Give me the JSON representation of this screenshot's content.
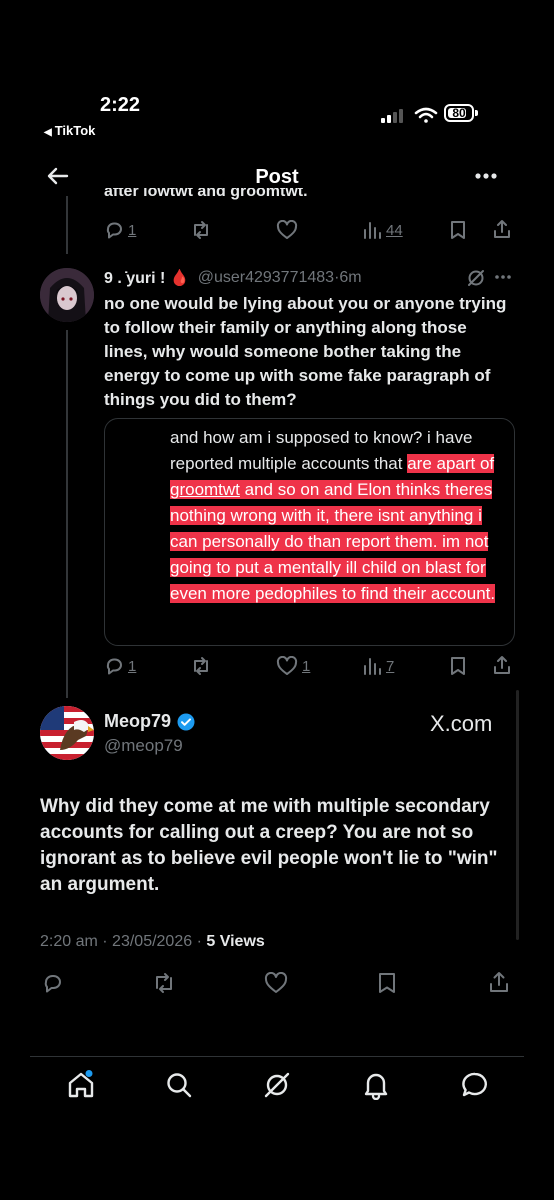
{
  "status_bar": {
    "time": "2:22",
    "back_app": "TikTok",
    "battery": "80"
  },
  "header": {
    "title": "Post"
  },
  "prev_tweet": {
    "cut_text": "after lowtwt and groomtwt.",
    "actions": {
      "replies": "1",
      "reposts": "",
      "likes": "",
      "views": "44"
    }
  },
  "reply": {
    "name": "9 . ̇yuri ! 🩸",
    "handle": "@user4293771483",
    "time": "6m",
    "body": "no one would be lying about you or anyone trying to follow their family or anything along those lines, why would someone bother taking the energy to come up with some fake paragraph of things you did to them?",
    "card": {
      "plain": "and how am i supposed to know? i have reported multiple accounts that",
      "hl_before": "are apart of ",
      "hl_link": "groomtwt",
      "hl_after": " and so on and Elon thinks theres nothing wrong with it, there isnt anything i can personally do than report them. im not going to put a mentally ill child on blast for even more pedophiles to find their account."
    },
    "actions": {
      "replies": "1",
      "reposts": "",
      "likes": "1",
      "views": "7"
    }
  },
  "main_tweet": {
    "name": "Meop79",
    "handle": "@meop79",
    "watermark": "X.com",
    "body": "Why did they come at me with multiple secondary accounts for calling out a creep? You are not so ignorant as to believe evil people won't lie to \"win\" an argument.",
    "time": "2:20 am",
    "date": "23/05/2026",
    "views_count": "5",
    "views_label": "Views"
  },
  "icons": [
    "back-arrow-icon",
    "more-icon",
    "reply-icon",
    "repost-icon",
    "like-icon",
    "views-icon",
    "bookmark-icon",
    "share-icon",
    "grok-icon",
    "verified-icon",
    "home-icon",
    "search-icon",
    "notifications-icon",
    "messages-icon"
  ],
  "colors": {
    "background": "#000000",
    "highlight": "#ef3349",
    "verified": "#1d9bf0",
    "muted": "#71767b"
  }
}
